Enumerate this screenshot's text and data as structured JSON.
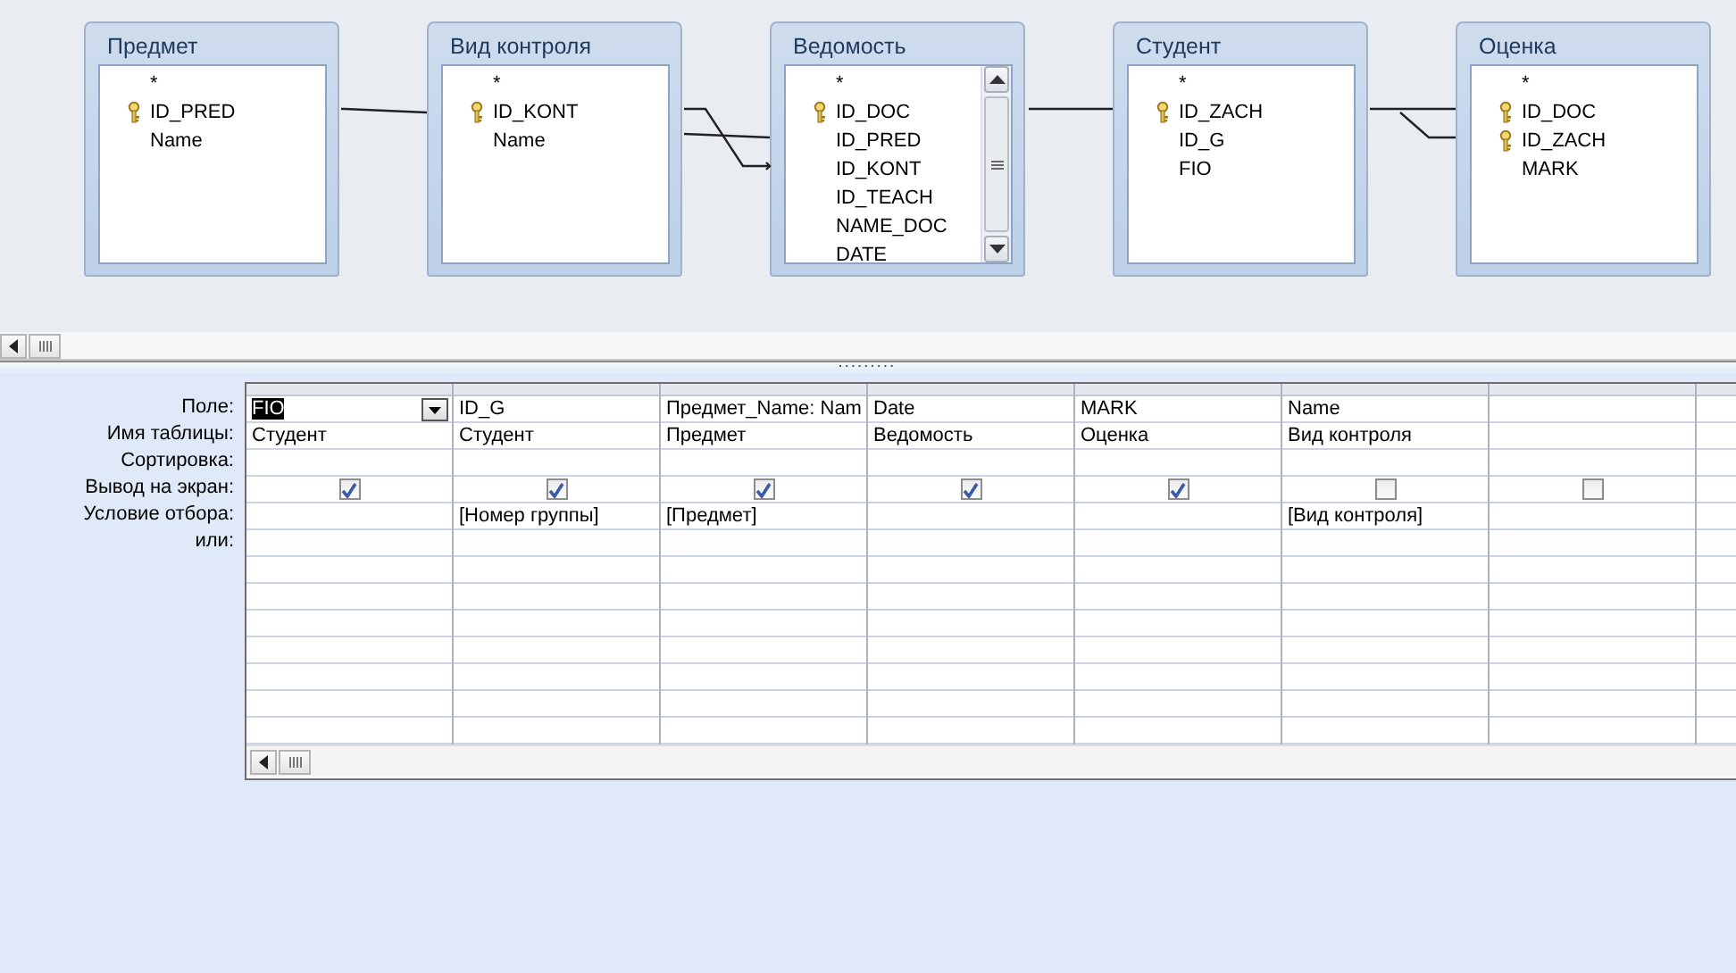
{
  "tables": [
    {
      "title": "Предмет",
      "scrollable": false,
      "fields": [
        {
          "name": "*",
          "key": false
        },
        {
          "name": "ID_PRED",
          "key": true
        },
        {
          "name": "Name",
          "key": false
        }
      ]
    },
    {
      "title": "Вид контроля",
      "scrollable": false,
      "fields": [
        {
          "name": "*",
          "key": false
        },
        {
          "name": "ID_KONT",
          "key": true
        },
        {
          "name": "Name",
          "key": false
        }
      ]
    },
    {
      "title": "Ведомость",
      "scrollable": true,
      "fields": [
        {
          "name": "*",
          "key": false
        },
        {
          "name": "ID_DOC",
          "key": true
        },
        {
          "name": "ID_PRED",
          "key": false
        },
        {
          "name": "ID_KONT",
          "key": false
        },
        {
          "name": "ID_TEACH",
          "key": false
        },
        {
          "name": "NAME_DOC",
          "key": false
        },
        {
          "name": "DATE",
          "key": false
        }
      ]
    },
    {
      "title": "Студент",
      "scrollable": false,
      "fields": [
        {
          "name": "*",
          "key": false
        },
        {
          "name": "ID_ZACH",
          "key": true
        },
        {
          "name": "ID_G",
          "key": false
        },
        {
          "name": "FIO",
          "key": false
        }
      ]
    },
    {
      "title": "Оценка",
      "scrollable": false,
      "fields": [
        {
          "name": "*",
          "key": false
        },
        {
          "name": "ID_DOC",
          "key": true
        },
        {
          "name": "ID_ZACH",
          "key": true
        },
        {
          "name": "MARK",
          "key": false
        }
      ]
    }
  ],
  "grid": {
    "row_labels": [
      "Поле:",
      "Имя таблицы:",
      "Сортировка:",
      "Вывод на экран:",
      "Условие отбора:",
      "или:"
    ],
    "columns": [
      {
        "field": "FIO",
        "table": "Студент",
        "show": true,
        "selected": true
      },
      {
        "field": "ID_G",
        "table": "Студент",
        "show": true,
        "criteria": "[Номер группы]",
        "selected": false
      },
      {
        "field": "Предмет_Name: Nam",
        "table": "Предмет",
        "show": true,
        "criteria": "[Предмет]",
        "selected": false
      },
      {
        "field": "Date",
        "table": "Ведомость",
        "show": true,
        "selected": false
      },
      {
        "field": "MARK",
        "table": "Оценка",
        "show": true,
        "selected": false
      },
      {
        "field": "Name",
        "table": "Вид контроля",
        "show": false,
        "criteria": "[Вид контроля]",
        "selected": false
      },
      {
        "show": false,
        "selected": false
      }
    ]
  }
}
